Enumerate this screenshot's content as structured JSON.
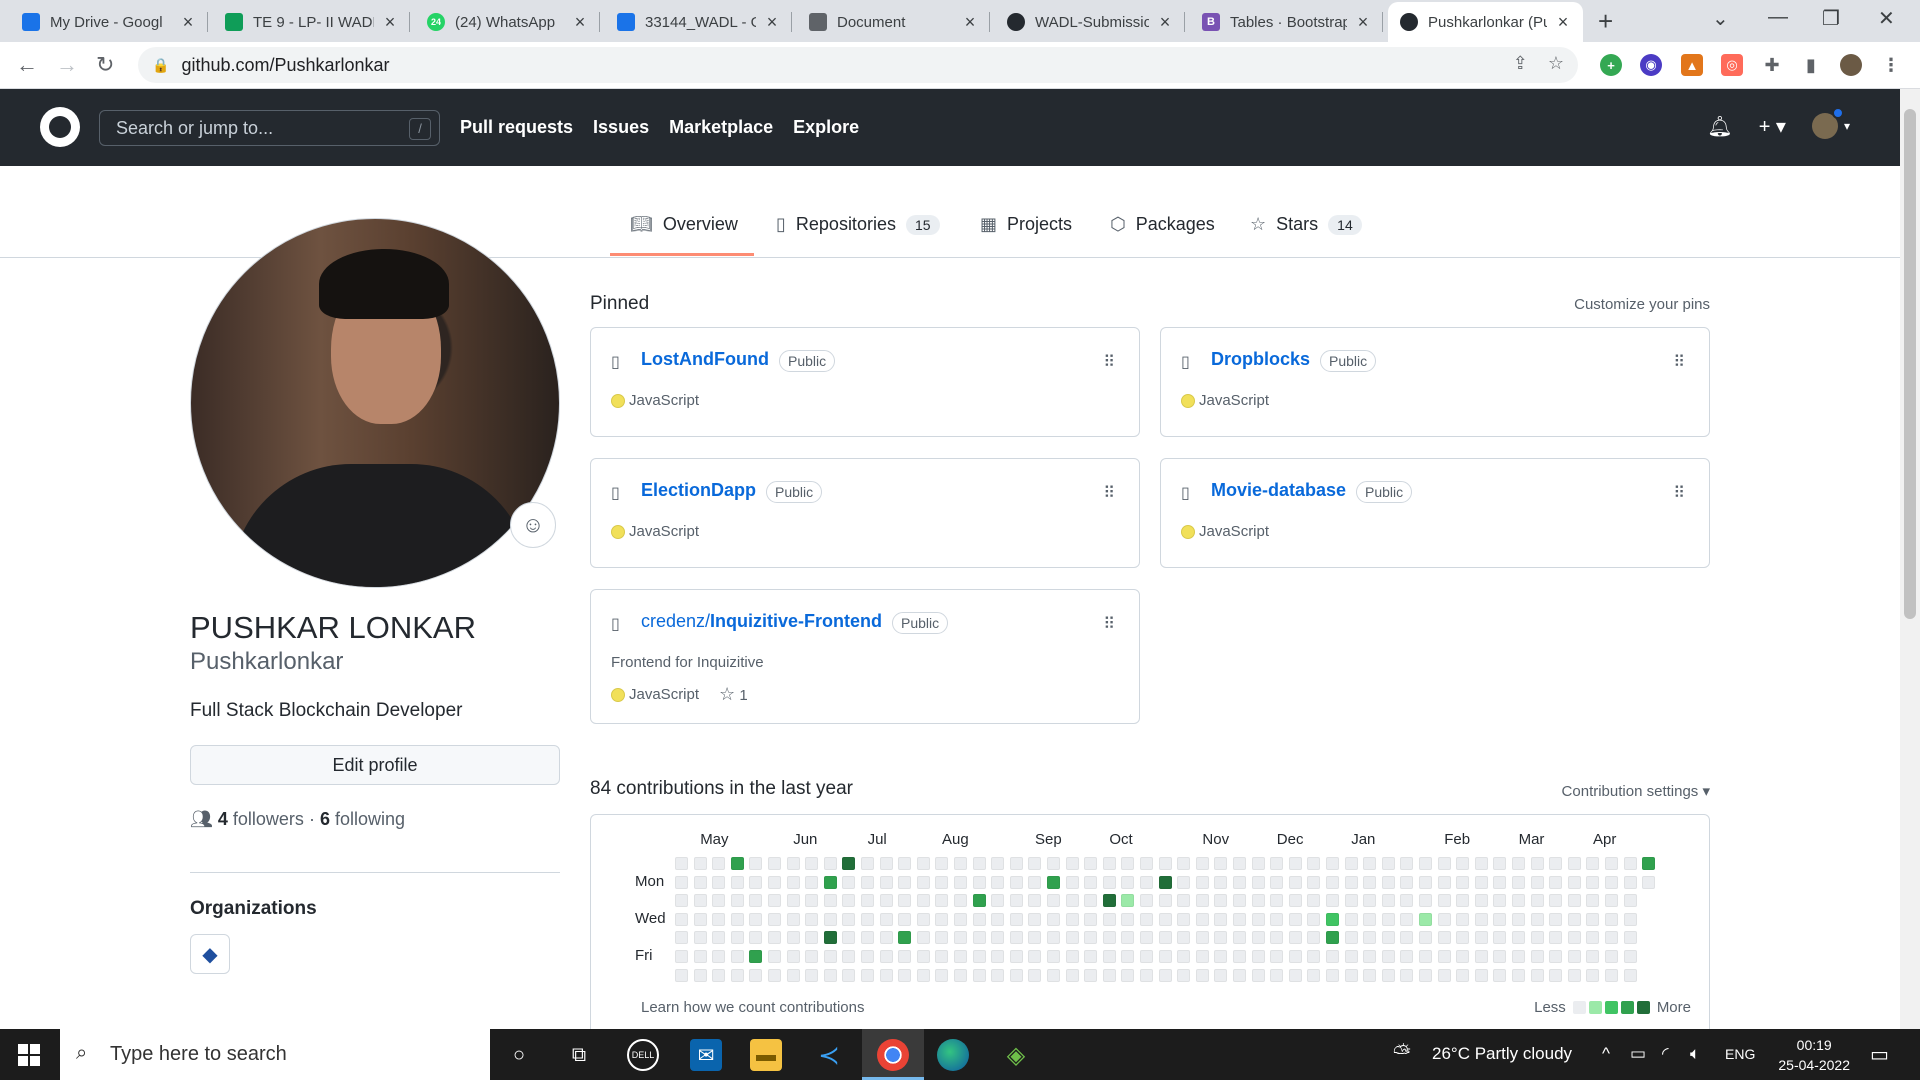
{
  "browser": {
    "tabs": [
      {
        "title": "My Drive - Googl",
        "icon": "google-drive-icon",
        "color": "#1a73e8"
      },
      {
        "title": "TE 9 - LP- II WADL",
        "icon": "google-sheets-icon",
        "color": "#0f9d58"
      },
      {
        "title": "(24) WhatsApp",
        "icon": "whatsapp-icon",
        "color": "#25d366",
        "badge": "24"
      },
      {
        "title": "33144_WADL - Go",
        "icon": "google-drive-icon",
        "color": "#1a73e8"
      },
      {
        "title": "Document",
        "icon": "globe-icon",
        "color": "#5f6368"
      },
      {
        "title": "WADL-Submissio",
        "icon": "github-icon",
        "color": "#24292f"
      },
      {
        "title": "Tables · Bootstrap",
        "icon": "bootstrap-icon",
        "color": "#7952b3",
        "letter": "B"
      },
      {
        "title": "Pushkarlonkar (Pu",
        "icon": "github-icon",
        "color": "#24292f"
      }
    ],
    "url": "github.com/Pushkarlonkar"
  },
  "github": {
    "search_placeholder": "Search or jump to...",
    "search_key": "/",
    "nav": [
      "Pull requests",
      "Issues",
      "Marketplace",
      "Explore"
    ]
  },
  "profile_tabs": [
    {
      "label": "Overview",
      "icon": "book-icon"
    },
    {
      "label": "Repositories",
      "count": "15",
      "icon": "repo-icon"
    },
    {
      "label": "Projects",
      "icon": "table-icon"
    },
    {
      "label": "Packages",
      "icon": "package-icon"
    },
    {
      "label": "Stars",
      "count": "14",
      "icon": "star-icon"
    }
  ],
  "profile": {
    "name": "PUSHKAR LONKAR",
    "login": "Pushkarlonkar",
    "bio": "Full Stack Blockchain Developer",
    "edit_label": "Edit profile",
    "followers": "4",
    "followers_label": "followers",
    "separator": "·",
    "following": "6",
    "following_label": "following",
    "orgs_title": "Organizations"
  },
  "pinned": {
    "title": "Pinned",
    "customize": "Customize your pins",
    "repos": [
      {
        "owner": "",
        "name": "LostAndFound",
        "visibility": "Public",
        "description": "",
        "language": "JavaScript",
        "stars": ""
      },
      {
        "owner": "",
        "name": "Dropblocks",
        "visibility": "Public",
        "description": "",
        "language": "JavaScript",
        "stars": ""
      },
      {
        "owner": "",
        "name": "ElectionDapp",
        "visibility": "Public",
        "description": "",
        "language": "JavaScript",
        "stars": ""
      },
      {
        "owner": "",
        "name": "Movie-database",
        "visibility": "Public",
        "description": "",
        "language": "JavaScript",
        "stars": ""
      },
      {
        "owner": "credenz/",
        "name": "Inquizitive-Frontend",
        "visibility": "Public",
        "description": "Frontend for Inquizitive",
        "language": "JavaScript",
        "stars": "1"
      }
    ],
    "language_color": "#f1e05a"
  },
  "contributions": {
    "title": "84 contributions in the last year",
    "settings": "Contribution settings ▾",
    "months": [
      "May",
      "Jun",
      "Jul",
      "Aug",
      "Sep",
      "Oct",
      "Nov",
      "Dec",
      "Jan",
      "Feb",
      "Mar",
      "Apr"
    ],
    "days": [
      "Mon",
      "Wed",
      "Fri"
    ],
    "learn": "Learn how we count contributions",
    "less": "Less",
    "more": "More",
    "levels": [
      "#ebedf0",
      "#9be9a8",
      "#40c463",
      "#30a14e",
      "#216e39"
    ],
    "active_cells": [
      {
        "week": 3,
        "day": 0,
        "level": 3
      },
      {
        "week": 4,
        "day": 5,
        "level": 3
      },
      {
        "week": 8,
        "day": 1,
        "level": 3
      },
      {
        "week": 8,
        "day": 4,
        "level": 4
      },
      {
        "week": 9,
        "day": 0,
        "level": 4
      },
      {
        "week": 12,
        "day": 4,
        "level": 3
      },
      {
        "week": 16,
        "day": 2,
        "level": 3
      },
      {
        "week": 20,
        "day": 1,
        "level": 3
      },
      {
        "week": 23,
        "day": 2,
        "level": 4
      },
      {
        "week": 24,
        "day": 2,
        "level": 1
      },
      {
        "week": 26,
        "day": 1,
        "level": 4
      },
      {
        "week": 35,
        "day": 3,
        "level": 2
      },
      {
        "week": 35,
        "day": 4,
        "level": 3
      },
      {
        "week": 40,
        "day": 3,
        "level": 1
      },
      {
        "week": 52,
        "day": 0,
        "level": 3
      }
    ]
  },
  "taskbar": {
    "search_placeholder": "Type here to search",
    "weather": "26°C  Partly cloudy",
    "lang": "ENG",
    "time": "00:19",
    "date": "25-04-2022"
  }
}
